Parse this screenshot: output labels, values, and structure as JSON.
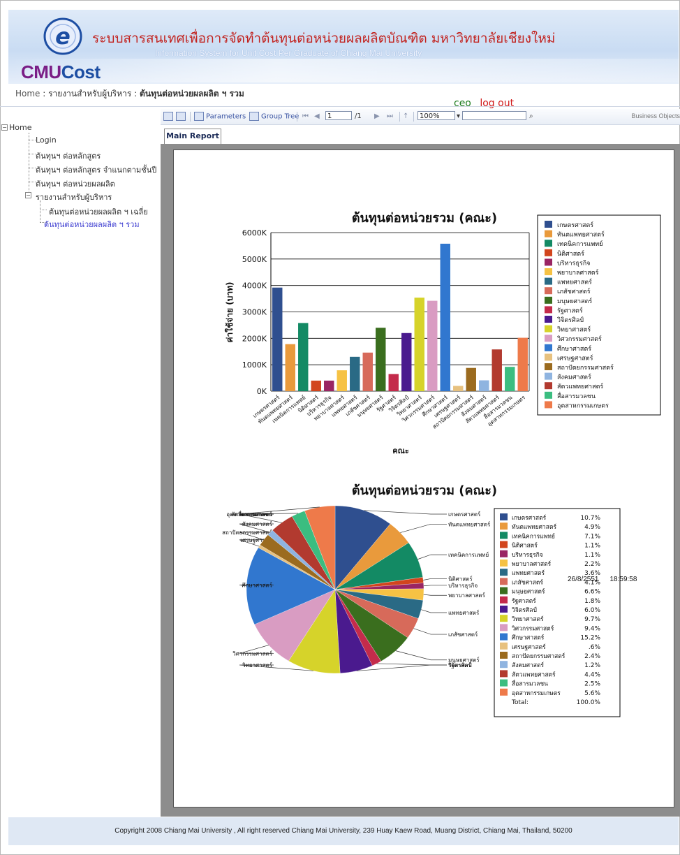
{
  "header": {
    "logo_prefix": "CMU",
    "logo_suffix": "Cost",
    "title_th": "ระบบสารสนเทศเพื่อการจัดทำต้นทุนต่อหน่วยผลผลิตบัณฑิต มหาวิทยาลัยเชียงใหม่",
    "title_en": "Information System for Unit Cost Per Graduate of Chiang Mai University"
  },
  "breadcrumb": {
    "home": "Home",
    "sep1": " : ",
    "section": "รายงานสำหรับผู้บริหาร",
    "sep2": " : ",
    "current": "ต้นทุนต่อหน่วยผลผลิต ฯ รวม"
  },
  "userbar": {
    "user": "ceo",
    "logout": "log out"
  },
  "sidebar": {
    "root": "Home",
    "items": [
      "Login",
      "ต้นทุนฯ ต่อหลักสูตร",
      "ต้นทุนฯ ต่อหลักสูตร จำแนกตามชั้นปี",
      "ต้นทุนฯ ต่อหน่วยผลผลิต",
      "รายงานสำหรับผู้บริหาร"
    ],
    "subitems": [
      "ต้นทุนต่อหน่วยผลผลิต ฯ เฉลี่ย",
      "ต้นทุนต่อหน่วยผลผลิต ฯ รวม"
    ],
    "collapse_glyph": "−"
  },
  "toolbar": {
    "parameters": "Parameters",
    "group_tree": "Group Tree",
    "page_value": "1",
    "page_total": "/1",
    "zoom": "100%",
    "brand": "Business Objects"
  },
  "tabs": {
    "main_report": "Main Report"
  },
  "report": {
    "date": "26/8/2551",
    "time": "18:59:58"
  },
  "chart_data": [
    {
      "type": "bar",
      "title": "ต้นทุนต่อหน่วยรวม (คณะ)",
      "xlabel": "คณะ",
      "ylabel": "ค่าใช้จ่าย (บาท)",
      "ylim": [
        0,
        6000
      ],
      "yticks": [
        "0K",
        "1000K",
        "2000K",
        "3000K",
        "4000K",
        "5000K",
        "6000K"
      ],
      "grid": true,
      "legend": "right",
      "categories": [
        "เกษตรศาสตร์",
        "ทันตแพทยศาสตร์",
        "เทคนิคการแพทย์",
        "นิติศาสตร์",
        "บริหารธุรกิจ",
        "พยาบาลศาสตร์",
        "แพทยศาสตร์",
        "เภสัชศาสตร์",
        "มนุษยศาสตร์",
        "รัฐศาสตร์",
        "วิจิตรศิลป์",
        "วิทยาศาสตร์",
        "วิศวกรรมศาสตร์",
        "ศึกษาศาสตร์",
        "เศรษฐศาสตร์",
        "สถาปัตยกรรมศาสตร์",
        "สังคมศาสตร์",
        "สัตวแพทยศาสตร์",
        "สื่อสารมวลชน",
        "อุตสาหกรรมเกษตร"
      ],
      "values": [
        3920,
        1780,
        2580,
        400,
        400,
        790,
        1300,
        1460,
        2400,
        650,
        2200,
        3540,
        3420,
        5580,
        200,
        880,
        410,
        1580,
        920,
        2020
      ],
      "colors": [
        "#2f4f8f",
        "#e99a3c",
        "#138a64",
        "#d2451d",
        "#9a2563",
        "#f6c244",
        "#2a6a85",
        "#d76a5a",
        "#3a6e1e",
        "#c42b4b",
        "#4a1a8e",
        "#d6d32a",
        "#d99cc2",
        "#3177cf",
        "#e7c17f",
        "#9b6b1f",
        "#8fb4e0",
        "#b23a2f",
        "#3bbd80",
        "#ee7a4a"
      ]
    },
    {
      "type": "pie",
      "title": "ต้นทุนต่อหน่วยรวม (คณะ)",
      "legend": "right",
      "categories": [
        "เกษตรศาสตร์",
        "ทันตแพทยศาสตร์",
        "เทคนิคการแพทย์",
        "นิติศาสตร์",
        "บริหารธุรกิจ",
        "พยาบาลศาสตร์",
        "แพทยศาสตร์",
        "เภสัชศาสตร์",
        "มนุษยศาสตร์",
        "รัฐศาสตร์",
        "วิจิตรศิลป์",
        "วิทยาศาสตร์",
        "วิศวกรรมศาสตร์",
        "ศึกษาศาสตร์",
        "เศรษฐศาสตร์",
        "สถาปัตยกรรมศาสตร์",
        "สังคมศาสตร์",
        "สัตวแพทยศาสตร์",
        "สื่อสารมวลชน",
        "อุตสาหกรรมเกษตร"
      ],
      "values": [
        10.7,
        4.9,
        7.1,
        1.1,
        1.1,
        2.2,
        3.6,
        4.1,
        6.6,
        1.8,
        6.0,
        9.7,
        9.4,
        15.2,
        0.6,
        2.4,
        1.2,
        4.4,
        2.5,
        5.6
      ],
      "percent_labels": [
        "10.7%",
        "4.9%",
        "7.1%",
        "1.1%",
        "1.1%",
        "2.2%",
        "3.6%",
        "4.1%",
        "6.6%",
        "1.8%",
        "6.0%",
        "9.7%",
        "9.4%",
        "15.2%",
        ".6%",
        "2.4%",
        "1.2%",
        "4.4%",
        "2.5%",
        "5.6%"
      ],
      "total_label": "Total:",
      "total_value": "100.0%"
    }
  ],
  "footer": {
    "copyright": "Copyright 2008 Chiang Mai University , All right reserved Chiang Mai University, 239 Huay Kaew Road, Muang District, Chiang Mai, Thailand, 50200"
  }
}
